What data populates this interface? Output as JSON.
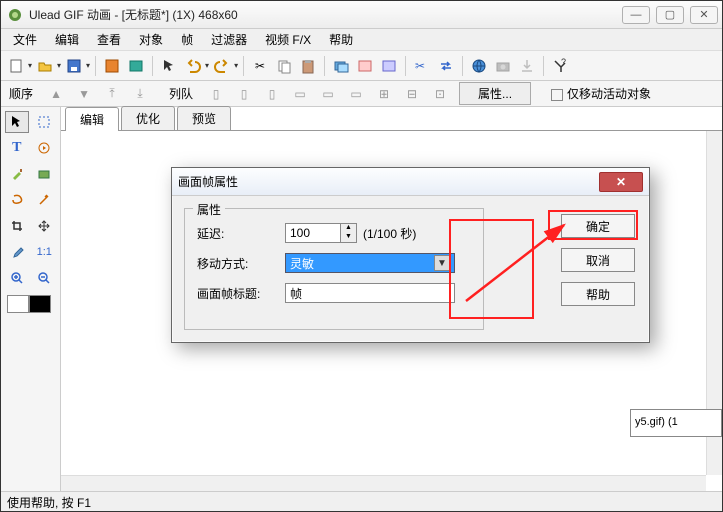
{
  "window": {
    "title": "Ulead GIF 动画 - [无标题*] (1X) 468x60",
    "min": "—",
    "max": "▢",
    "close": "✕"
  },
  "menu": [
    "文件",
    "编辑",
    "查看",
    "对象",
    "帧",
    "过滤器",
    "视频 F/X",
    "帮助"
  ],
  "toolbar2": {
    "seq_label": "顺序",
    "queue_label": "列队",
    "prop_btn": "属性...",
    "chk_label": "仅移动活动对象"
  },
  "tabs": [
    "编辑",
    "优化",
    "预览"
  ],
  "dialog": {
    "title": "画面帧属性",
    "close": "✕",
    "group": "属性",
    "delay_label": "延迟:",
    "delay_value": "100",
    "delay_unit": "(1/100 秒)",
    "move_label": "移动方式:",
    "move_value": "灵敏",
    "title_label": "画面帧标题:",
    "title_value": "帧",
    "ok": "确定",
    "cancel": "取消",
    "help": "帮助"
  },
  "thumb_peek": "y5.gif) (1",
  "status": "使用帮助, 按 F1"
}
